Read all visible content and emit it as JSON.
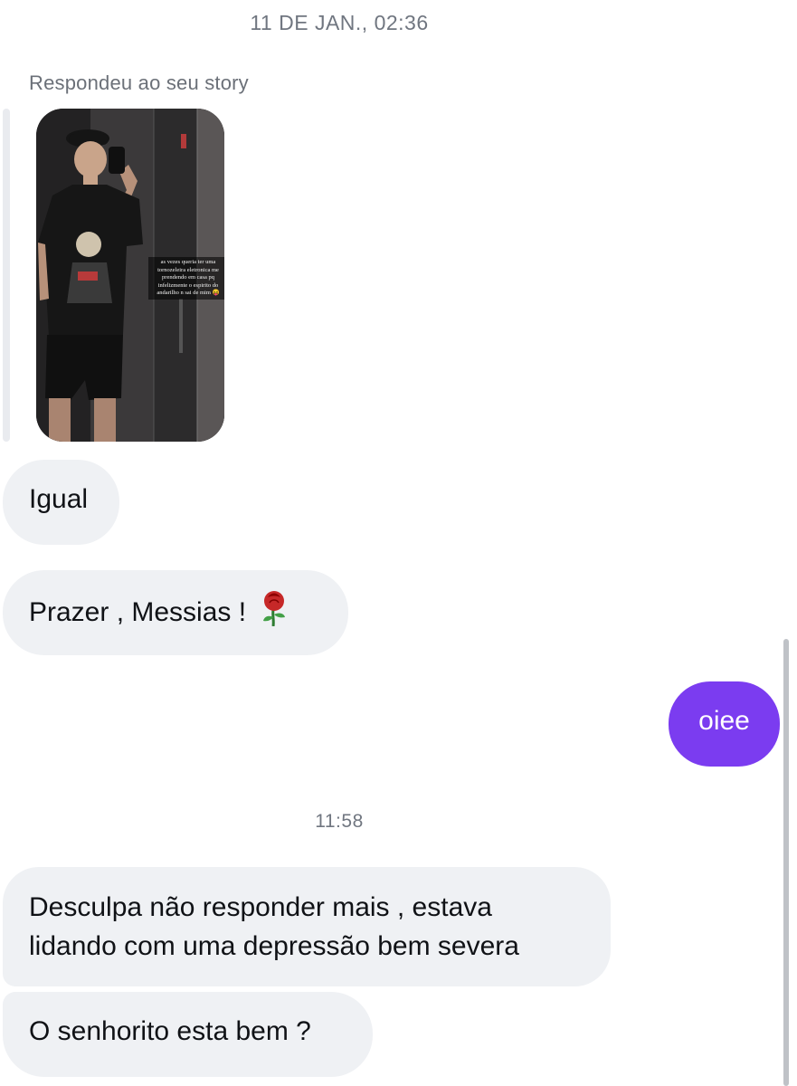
{
  "thread": {
    "timestamp_1": "11 DE JAN., 02:36",
    "timestamp_2": "11:58",
    "story_reply": {
      "label": "Respondeu ao seu story",
      "caption": "as vezes queria ter uma tornozeleira eletronica me prendendo em casa pq infelizmente o espirito do andarilho n sai de mim 😝"
    },
    "messages": [
      {
        "direction": "incoming",
        "text": "Igual"
      },
      {
        "direction": "incoming",
        "text": "Prazer , Messias !",
        "emoji": "rose-icon"
      },
      {
        "direction": "outgoing",
        "text": "oiee"
      },
      {
        "direction": "incoming",
        "text": "Desculpa não responder mais , estava lidando com uma depressão bem severa"
      },
      {
        "direction": "incoming",
        "text": "O senhorito esta bem ?"
      }
    ]
  },
  "colors": {
    "incoming_bubble": "#eff1f4",
    "outgoing_bubble": "#7b3cf0",
    "timestamp_text": "#707680"
  }
}
